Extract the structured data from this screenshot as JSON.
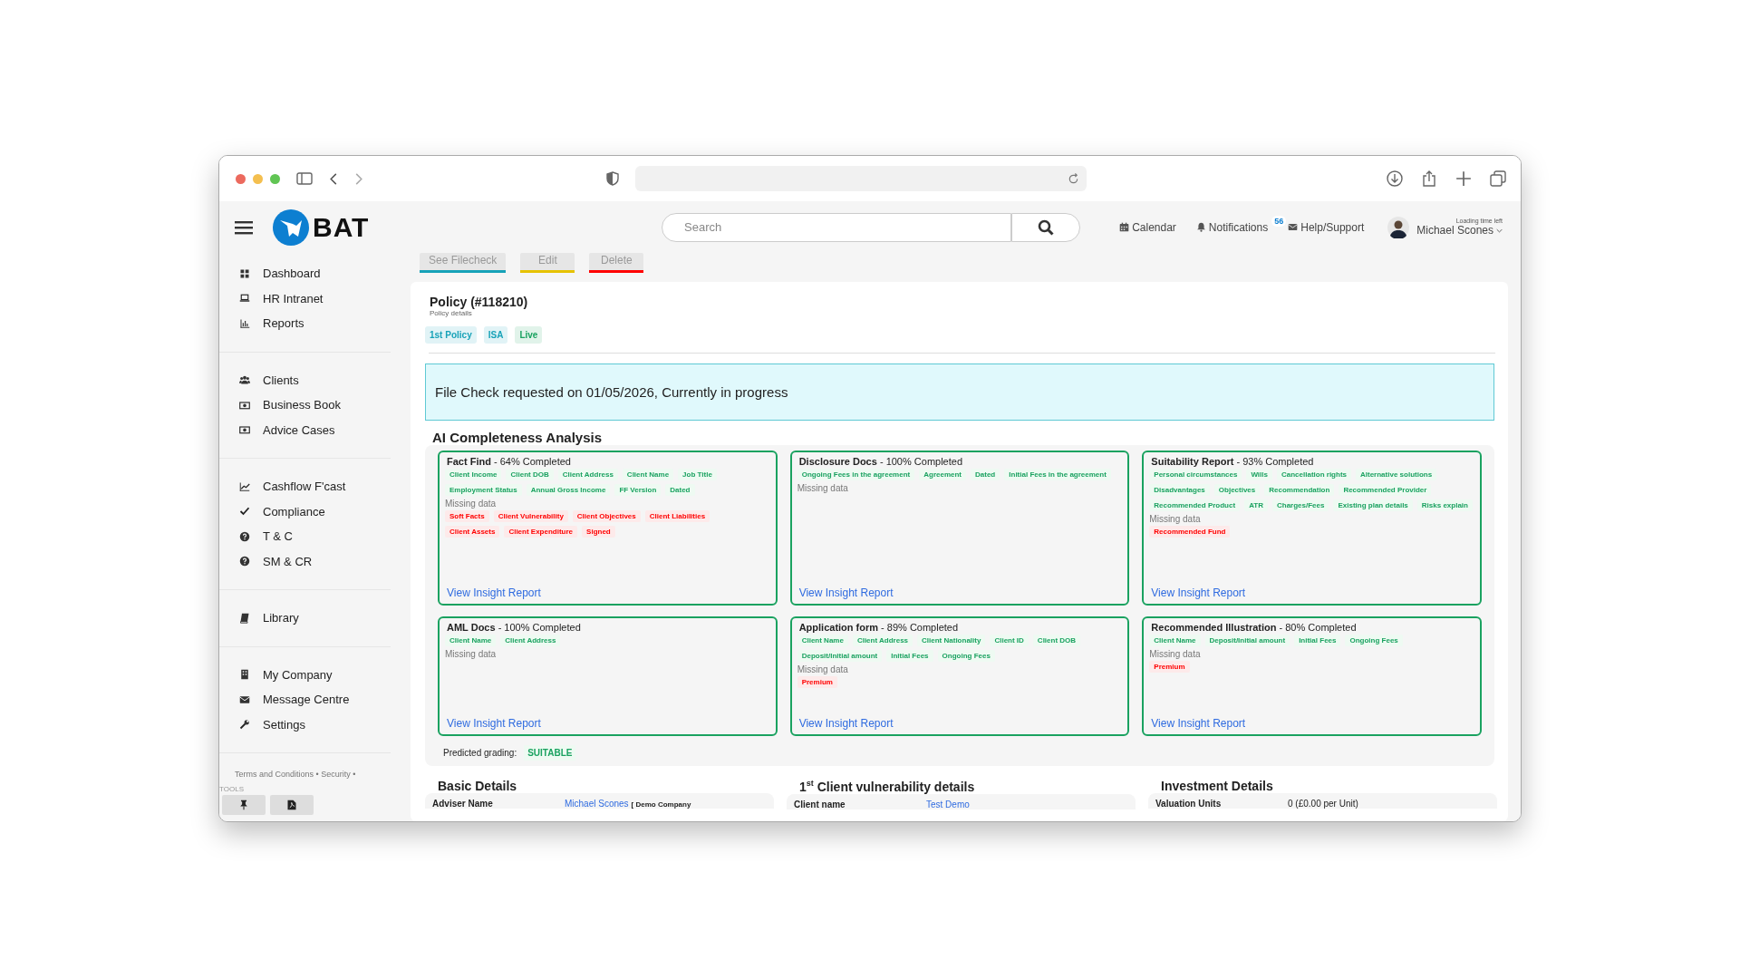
{
  "header": {
    "logo": "BAT",
    "search": {
      "placeholder": "Search"
    },
    "links": [
      {
        "label": "Calendar"
      },
      {
        "label": "Notifications",
        "badge": "56"
      },
      {
        "label": "Help/Support"
      }
    ],
    "user": {
      "note": "Loading time left",
      "name": "Michael Scones"
    }
  },
  "sidebar": {
    "groups": [
      [
        {
          "label": "Dashboard"
        },
        {
          "label": "HR Intranet"
        },
        {
          "label": "Reports"
        }
      ],
      [
        {
          "label": "Clients"
        },
        {
          "label": "Business Book"
        },
        {
          "label": "Advice Cases"
        }
      ],
      [
        {
          "label": "Cashflow F'cast"
        },
        {
          "label": "Compliance"
        },
        {
          "label": "T & C"
        },
        {
          "label": "SM & CR"
        }
      ],
      [
        {
          "label": "Library"
        }
      ],
      [
        {
          "label": "My Company"
        },
        {
          "label": "Message Centre"
        },
        {
          "label": "Settings"
        }
      ]
    ],
    "footer": "Terms and Conditions • Security •",
    "tools_label": "TOOLS"
  },
  "actions": [
    {
      "label": "See Filecheck",
      "color": "#17a2b8"
    },
    {
      "label": "Edit",
      "color": "#e6c200"
    },
    {
      "label": "Delete",
      "color": "#ff0000"
    }
  ],
  "policy": {
    "title": "Policy (#118210)",
    "subtitle": "Policy details",
    "tags": [
      {
        "label": "1st Policy",
        "color": "#17a2b8"
      },
      {
        "label": "ISA",
        "color": "#17a2b8"
      },
      {
        "label": "Live",
        "color": "#1aa260"
      }
    ]
  },
  "alert": "File Check requested on 01/05/2026, Currently in progress",
  "analysis": {
    "title": "AI Completeness Analysis",
    "cards": [
      {
        "name": "Fact Find",
        "status": " - 64% Completed",
        "found": [
          "Client Income",
          "Client DOB",
          "Client Address",
          "Client Name",
          "Job Title",
          "Employment Status",
          "Annual Gross Income",
          "FF Version",
          "Dated"
        ],
        "missing_label": "Missing data",
        "missing": [
          "Soft Facts",
          "Client Vulnerability",
          "Client Objectives",
          "Client Liabilities",
          "Client Assets",
          "Client Expenditure",
          "Signed"
        ],
        "link": "View Insight Report"
      },
      {
        "name": "Disclosure Docs",
        "status": " - 100% Completed",
        "found": [
          "Ongoing Fees in the agreement",
          "Agreement",
          "Dated",
          "Initial Fees in the agreement"
        ],
        "missing_label": "Missing data",
        "link": "View Insight Report"
      },
      {
        "name": "Suitability Report",
        "status": " - 93% Completed",
        "found": [
          "Personal circumstances",
          "Wills",
          "Cancellation rights",
          "Alternative solutions",
          "Disadvantages",
          "Objectives",
          "Recommendation",
          "Recommended Provider",
          "Recommended Product",
          "ATR",
          "Charges/Fees",
          "Existing plan details",
          "Risks explain"
        ],
        "missing_label": "Missing data",
        "missing": [
          "Recommended Fund"
        ],
        "link": "View Insight Report"
      },
      {
        "name": "AML Docs",
        "status": " - 100% Completed",
        "found": [
          "Client Name",
          "Client Address"
        ],
        "missing_label": "Missing data",
        "link": "View Insight Report"
      },
      {
        "name": "Application form",
        "status": " - 89% Completed",
        "found": [
          "Client Name",
          "Client Address",
          "Client Nationality",
          "Client ID",
          "Client DOB",
          "Deposit/Initial amount",
          "Initial Fees",
          "Ongoing Fees"
        ],
        "missing_label": "Missing data",
        "missing": [
          "Premium"
        ],
        "link": "View Insight Report"
      },
      {
        "name": "Recommended Illustration",
        "status": " - 80% Completed",
        "found": [
          "Client Name",
          "Deposit/Initial amount",
          "Initial Fees",
          "Ongoing Fees"
        ],
        "missing_label": "Missing data",
        "missing": [
          "Premium"
        ],
        "link": "View Insight Report"
      }
    ],
    "grading_label": "Predicted grading:",
    "grading": "SUITABLE"
  },
  "details": [
    {
      "title": "Basic Details",
      "rows": [
        {
          "label": "Adviser Name",
          "value": "Michael Scones",
          "extra": "[ Demo Company"
        }
      ]
    },
    {
      "title": "1$^{st}$ Client vulnerability details",
      "rows": [
        {
          "label": "Client name",
          "value": "Test Demo"
        }
      ]
    },
    {
      "title": "Investment Details",
      "rows": [
        {
          "label": "Valuation Units",
          "text": "0 (£0.00 per Unit)"
        }
      ]
    }
  ]
}
